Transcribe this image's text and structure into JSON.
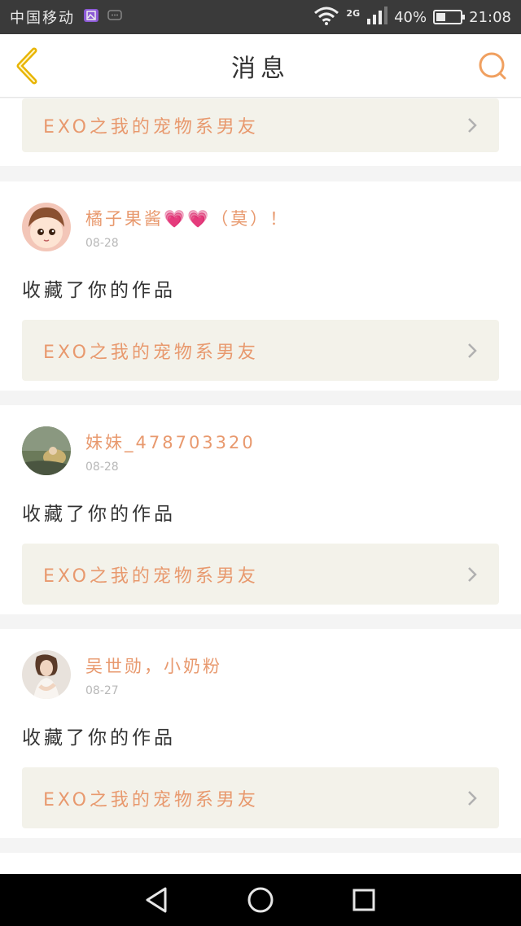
{
  "status_bar": {
    "carrier": "中国移动",
    "network": "2G",
    "battery": "40%",
    "battery_level": 0.4,
    "time": "21:08"
  },
  "header": {
    "title": "消息",
    "back_icon": "chevron-left-icon",
    "search_icon": "search-icon"
  },
  "colors": {
    "accent": "#e8996e",
    "work_bg": "#f3f2ea",
    "back_icon": "#e8b400"
  },
  "top_partial": {
    "work_title": "EXO之我的宠物系男友"
  },
  "messages": [
    {
      "username": "橘子果酱💗💗（莫）！",
      "date": "08-28",
      "action": "收藏了你的作品",
      "work_title": "EXO之我的宠物系男友"
    },
    {
      "username": "妹妹_478703320",
      "date": "08-28",
      "action": "收藏了你的作品",
      "work_title": "EXO之我的宠物系男友"
    },
    {
      "username": "吴世勋，小奶粉",
      "date": "08-27",
      "action": "收藏了你的作品",
      "work_title": "EXO之我的宠物系男友"
    }
  ],
  "system_nav": {
    "back": "back-triangle-icon",
    "home": "home-circle-icon",
    "recents": "recents-square-icon"
  }
}
